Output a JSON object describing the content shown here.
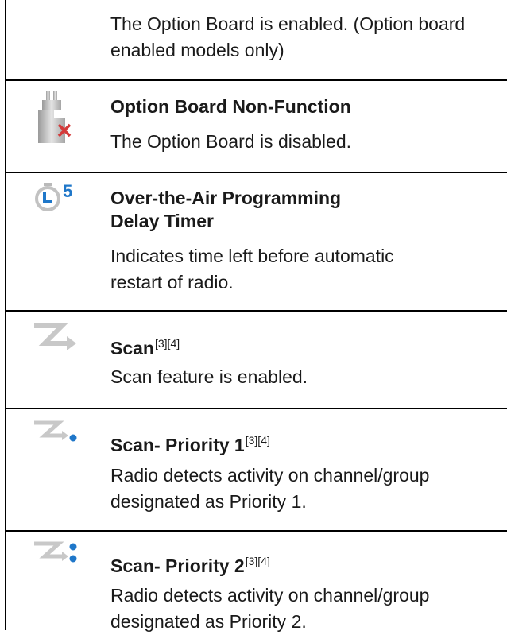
{
  "rows": [
    {
      "description": "The Option Board is enabled. (Option board enabled models only)"
    },
    {
      "icon": "option-board-disabled-icon",
      "title": "Option Board Non-Function",
      "description": "The Option Board is disabled."
    },
    {
      "icon": "ota-delay-timer-icon",
      "icon_digit": "5",
      "title": "Over-the-Air Programming Delay Timer",
      "description": "Indicates time left before automatic restart of radio."
    },
    {
      "icon": "scan-icon",
      "title": "Scan",
      "ref": "[3][4]",
      "description": "Scan feature is enabled."
    },
    {
      "icon": "scan-priority-1-icon",
      "title": "Scan- Priority 1",
      "ref": "[3][4]",
      "description": "Radio detects activity on channel/group designated as Priority 1."
    },
    {
      "icon": "scan-priority-2-icon",
      "title": "Scan- Priority 2",
      "ref": "[3][4]",
      "description": "Radio detects activity on channel/group designated as Priority 2."
    }
  ],
  "colors": {
    "rule": "#000000",
    "icon_blue": "#1f77c9",
    "icon_red": "#d43a3a",
    "icon_grey": "#b9b9b9"
  }
}
